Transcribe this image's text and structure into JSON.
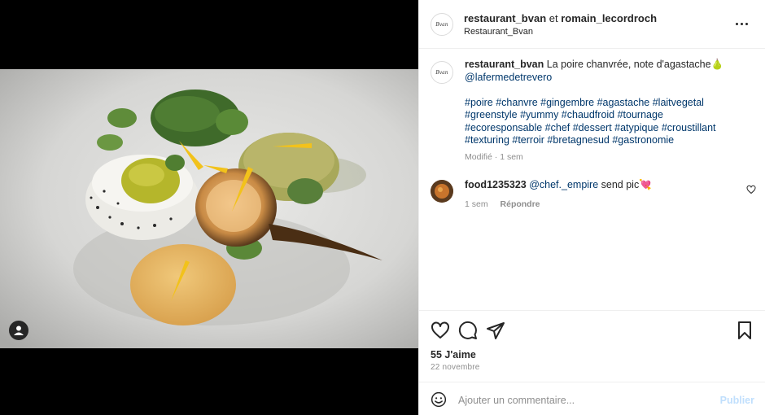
{
  "header": {
    "user1": "restaurant_bvan",
    "conjunction": "et",
    "user2": "romain_lecordroch",
    "location": "Restaurant_Bvan",
    "avatar_text": "Bvan"
  },
  "caption": {
    "username": "restaurant_bvan",
    "text": "La poire chanvrée, note d'agastache",
    "emoji": "🍐",
    "mention": "@lafermedetrevero",
    "hashtags": "#poire #chanvre #gingembre #agastache #laitvegetal #greenstyle #yummy #chaudfroid #tournage #ecoresponsable #chef #dessert #atypique #croustillant #texturing #terroir #bretagnesud #gastronomie",
    "edited": "Modifié",
    "dot": "·",
    "time": "1 sem"
  },
  "comment": {
    "username": "food1235323",
    "mention": "@chef._empire",
    "text": "send pic",
    "emoji": "💘",
    "time": "1 sem",
    "reply": "Répondre"
  },
  "engagement": {
    "likes": "55 J'aime",
    "date": "22 novembre"
  },
  "add_comment": {
    "placeholder": "Ajouter un commentaire...",
    "post_label": "Publier"
  },
  "icons": [
    "like-icon",
    "comment-icon",
    "share-icon",
    "save-icon",
    "more-options-icon",
    "emoji-icon",
    "user-tag-icon",
    "comment-like-icon"
  ]
}
